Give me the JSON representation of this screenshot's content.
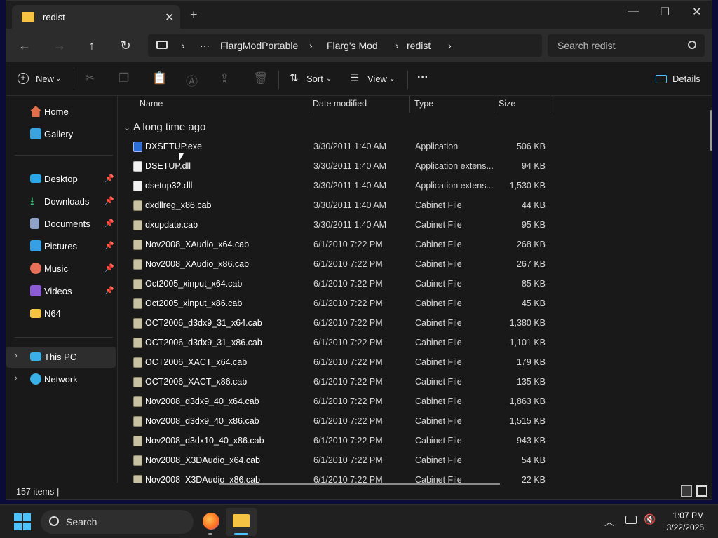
{
  "colors": {
    "accent": "#4cc2ff",
    "folder": "#f6c343",
    "window_bg": "#191919",
    "desktop": "#0b0b3a"
  },
  "tab": {
    "title": "redist",
    "close_icon": "close-icon",
    "new_tab_icon": "plus-icon"
  },
  "window_controls": {
    "minimize": "minimize-icon",
    "maximize": "maximize-icon",
    "close": "close-icon"
  },
  "address": {
    "crumbs": [
      "FlargModPortable",
      "Flarg's Mod",
      "redist"
    ],
    "overflow": "···"
  },
  "search": {
    "placeholder": "Search redist"
  },
  "toolbar": {
    "new_label": "New",
    "sort_label": "Sort",
    "view_label": "View",
    "more_label": "···",
    "details_label": "Details"
  },
  "sidebar": {
    "items": [
      {
        "label": "Home",
        "icon": "home-icon",
        "pinned": false
      },
      {
        "label": "Gallery",
        "icon": "gallery-icon",
        "pinned": false
      },
      {
        "label": "Desktop",
        "icon": "desktop-icon",
        "pinned": true
      },
      {
        "label": "Downloads",
        "icon": "download-icon",
        "pinned": true
      },
      {
        "label": "Documents",
        "icon": "documents-icon",
        "pinned": true
      },
      {
        "label": "Pictures",
        "icon": "pictures-icon",
        "pinned": true
      },
      {
        "label": "Music",
        "icon": "music-icon",
        "pinned": true
      },
      {
        "label": "Videos",
        "icon": "videos-icon",
        "pinned": true
      },
      {
        "label": "N64",
        "icon": "folder-icon",
        "pinned": false
      },
      {
        "label": "This PC",
        "icon": "pc-icon",
        "pinned": false
      },
      {
        "label": "Network",
        "icon": "network-icon",
        "pinned": false
      }
    ]
  },
  "columns": {
    "name": "Name",
    "date": "Date modified",
    "type": "Type",
    "size": "Size"
  },
  "group": {
    "label": "A long time ago"
  },
  "files": [
    {
      "name": "DXSETUP.exe",
      "date": "3/30/2011 1:40 AM",
      "type": "Application",
      "size": "506 KB"
    },
    {
      "name": "DSETUP.dll",
      "date": "3/30/2011 1:40 AM",
      "type": "Application extens...",
      "size": "94 KB"
    },
    {
      "name": "dsetup32.dll",
      "date": "3/30/2011 1:40 AM",
      "type": "Application extens...",
      "size": "1,530 KB"
    },
    {
      "name": "dxdllreg_x86.cab",
      "date": "3/30/2011 1:40 AM",
      "type": "Cabinet File",
      "size": "44 KB"
    },
    {
      "name": "dxupdate.cab",
      "date": "3/30/2011 1:40 AM",
      "type": "Cabinet File",
      "size": "95 KB"
    },
    {
      "name": "Nov2008_XAudio_x64.cab",
      "date": "6/1/2010 7:22 PM",
      "type": "Cabinet File",
      "size": "268 KB"
    },
    {
      "name": "Nov2008_XAudio_x86.cab",
      "date": "6/1/2010 7:22 PM",
      "type": "Cabinet File",
      "size": "267 KB"
    },
    {
      "name": "Oct2005_xinput_x64.cab",
      "date": "6/1/2010 7:22 PM",
      "type": "Cabinet File",
      "size": "85 KB"
    },
    {
      "name": "Oct2005_xinput_x86.cab",
      "date": "6/1/2010 7:22 PM",
      "type": "Cabinet File",
      "size": "45 KB"
    },
    {
      "name": "OCT2006_d3dx9_31_x64.cab",
      "date": "6/1/2010 7:22 PM",
      "type": "Cabinet File",
      "size": "1,380 KB"
    },
    {
      "name": "OCT2006_d3dx9_31_x86.cab",
      "date": "6/1/2010 7:22 PM",
      "type": "Cabinet File",
      "size": "1,101 KB"
    },
    {
      "name": "OCT2006_XACT_x64.cab",
      "date": "6/1/2010 7:22 PM",
      "type": "Cabinet File",
      "size": "179 KB"
    },
    {
      "name": "OCT2006_XACT_x86.cab",
      "date": "6/1/2010 7:22 PM",
      "type": "Cabinet File",
      "size": "135 KB"
    },
    {
      "name": "Nov2008_d3dx9_40_x64.cab",
      "date": "6/1/2010 7:22 PM",
      "type": "Cabinet File",
      "size": "1,863 KB"
    },
    {
      "name": "Nov2008_d3dx9_40_x86.cab",
      "date": "6/1/2010 7:22 PM",
      "type": "Cabinet File",
      "size": "1,515 KB"
    },
    {
      "name": "Nov2008_d3dx10_40_x86.cab",
      "date": "6/1/2010 7:22 PM",
      "type": "Cabinet File",
      "size": "943 KB"
    },
    {
      "name": "Nov2008_X3DAudio_x64.cab",
      "date": "6/1/2010 7:22 PM",
      "type": "Cabinet File",
      "size": "54 KB"
    },
    {
      "name": "Nov2008_X3DAudio_x86.cab",
      "date": "6/1/2010 7:22 PM",
      "type": "Cabinet File",
      "size": "22 KB"
    }
  ],
  "status": {
    "item_count": "157 items",
    "cursor": "|"
  },
  "taskbar": {
    "search_label": "Search",
    "time": "1:07 PM",
    "date": "3/22/2025"
  }
}
